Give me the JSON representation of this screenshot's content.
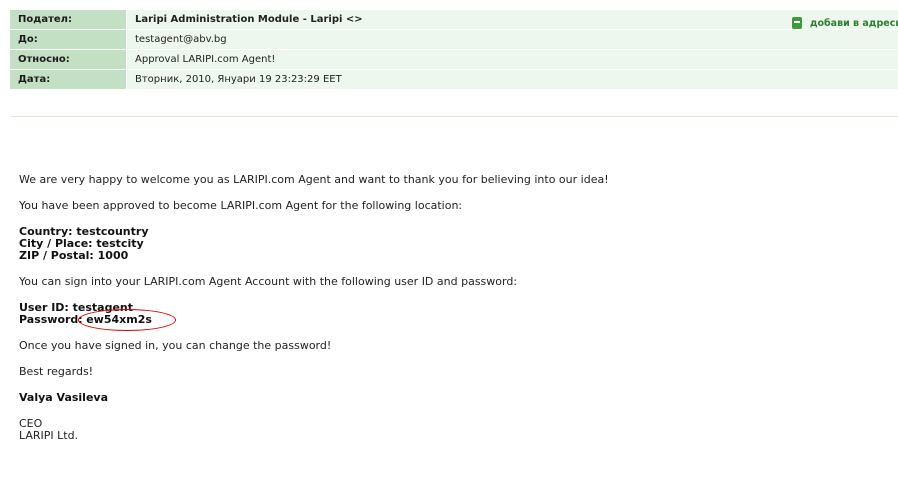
{
  "header": {
    "rows": [
      {
        "label": "Подател:",
        "value": "Laripi Administration Module - Laripi <>"
      },
      {
        "label": "До:",
        "value": "testagent@abv.bg"
      },
      {
        "label": "Относно:",
        "value": "Approval LARIPI.com Agent!"
      },
      {
        "label": "Дата:",
        "value": "Вторник, 2010, Януари 19 23:23:29 EET"
      }
    ],
    "add_contact_label": "добави в адреси"
  },
  "body": {
    "welcome": "We are very happy to welcome you as LARIPI.com Agent and want to thank you for believing into our idea!",
    "approved": "You have been approved to become LARIPI.com Agent for the following location:",
    "country": "Country: testcountry",
    "city": "City / Place: testcity",
    "zip": "ZIP / Postal: 1000",
    "sign_in_info": "You can sign into your LARIPI.com Agent Account with the following user ID and password:",
    "user_id": "User ID: testagent",
    "password_label": "Password:",
    "password_value": "ew54xm2s",
    "change_password": "Once you have signed in, you can change the password!",
    "regards": "Best regards!",
    "signer_name": "Valya Vasileva",
    "signer_title": "CEO",
    "signer_company": "LARIPI Ltd."
  },
  "colors": {
    "label_bg": "#c4e0c4",
    "value_bg": "#edf7ed",
    "highlight_ellipse": "#d40000",
    "add_contact_text": "#2e7d32"
  }
}
